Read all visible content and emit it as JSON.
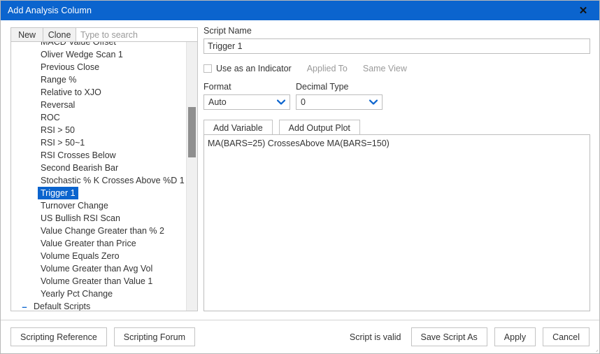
{
  "window": {
    "title": "Add Analysis Column",
    "close_icon": "close-icon",
    "close_glyph": "✕",
    "accent_color": "#0b64ce",
    "selection_color": "#0b64ce"
  },
  "left_panel": {
    "tabs": [
      {
        "label": "New"
      },
      {
        "label": "Clone"
      }
    ],
    "search": {
      "placeholder": "Type to search",
      "value": ""
    },
    "list_items": [
      {
        "label": "MACD Value Offset",
        "selected": false
      },
      {
        "label": "Oliver Wedge Scan 1",
        "selected": false
      },
      {
        "label": "Previous Close",
        "selected": false
      },
      {
        "label": "Range %",
        "selected": false
      },
      {
        "label": "Relative to XJO",
        "selected": false
      },
      {
        "label": "Reversal",
        "selected": false
      },
      {
        "label": "ROC",
        "selected": false
      },
      {
        "label": "RSI > 50",
        "selected": false
      },
      {
        "label": "RSI > 50~1",
        "selected": false
      },
      {
        "label": "RSI Crosses Below",
        "selected": false
      },
      {
        "label": "Second Bearish Bar",
        "selected": false
      },
      {
        "label": "Stochastic % K Crosses Above %D 1",
        "selected": false
      },
      {
        "label": "Trigger 1",
        "selected": true
      },
      {
        "label": "Turnover Change",
        "selected": false
      },
      {
        "label": "US Bullish RSI Scan",
        "selected": false
      },
      {
        "label": "Value Change Greater than % 2",
        "selected": false
      },
      {
        "label": "Value Greater than Price",
        "selected": false
      },
      {
        "label": "Volume Equals Zero",
        "selected": false
      },
      {
        "label": "Volume Greater than Avg Vol",
        "selected": false
      },
      {
        "label": "Volume Greater than Value 1",
        "selected": false
      },
      {
        "label": "Yearly Pct Change",
        "selected": false
      }
    ],
    "tree_node": {
      "label": "Default Scripts",
      "expander_glyph": "–",
      "expanded": true
    }
  },
  "right_panel": {
    "script_name_label": "Script Name",
    "script_name_value": "Trigger 1",
    "use_as_indicator": {
      "label": "Use as an Indicator",
      "checked": false
    },
    "applied_to_label": "Applied To",
    "same_view_label": "Same View",
    "format_label": "Format",
    "format_value": "Auto",
    "decimal_type_label": "Decimal Type",
    "decimal_type_value": "0",
    "chevron_glyph": "⌄",
    "add_variable_label": "Add Variable",
    "add_output_plot_label": "Add Output Plot",
    "script_text": "MA(BARS=25) CrossesAbove MA(BARS=150)"
  },
  "footer": {
    "scripting_reference_label": "Scripting Reference",
    "scripting_forum_label": "Scripting Forum",
    "status_text": "Script is valid",
    "save_script_as_label": "Save Script As",
    "apply_label": "Apply",
    "cancel_label": "Cancel"
  }
}
